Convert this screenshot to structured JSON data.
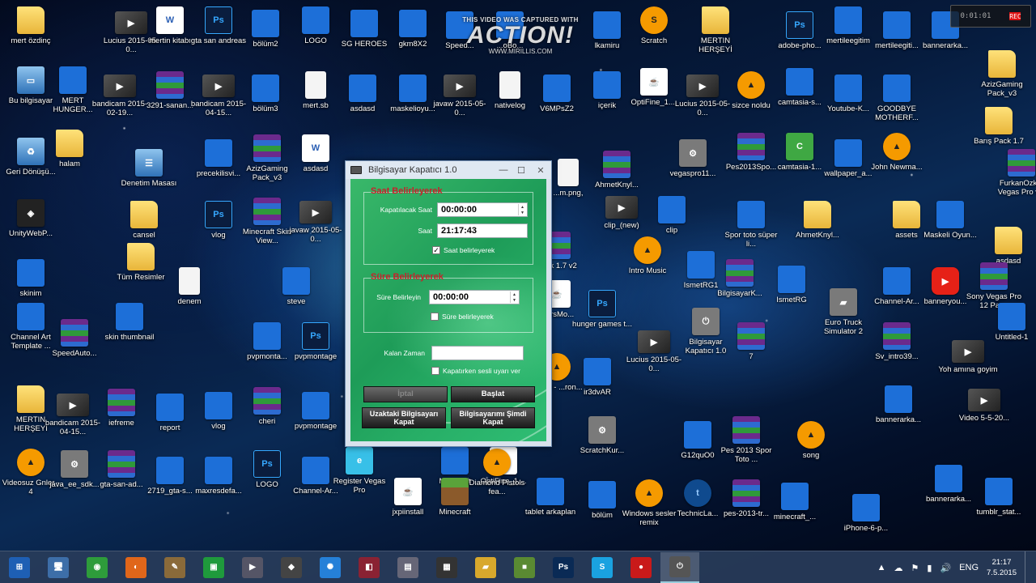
{
  "watermark": {
    "top_text": "THIS VIDEO WAS CAPTURED WITH",
    "logo": "ACTION!",
    "url": "WWW.MIRILLIS.COM"
  },
  "recorder": {
    "timer": "0:01:01",
    "rec": "REC"
  },
  "desktop_icons": [
    {
      "label": "mert özdinç",
      "icon": "folder-icon"
    },
    {
      "label": "Lucius 2015-05-0...",
      "icon": "video-icon"
    },
    {
      "label": "mertin kitabı",
      "icon": "word-icon"
    },
    {
      "label": "gta san andreas",
      "icon": "psd-icon"
    },
    {
      "label": "bölüm2",
      "icon": "image-icon"
    },
    {
      "label": "LOGO",
      "icon": "image-icon"
    },
    {
      "label": "SG HEROES",
      "icon": "image-icon"
    },
    {
      "label": "gkm8X2",
      "icon": "image-icon"
    },
    {
      "label": "Speed...",
      "icon": "image-icon"
    },
    {
      "label": "...oBo...",
      "icon": "image-icon"
    },
    {
      "label": "lkamiru",
      "icon": "image-icon"
    },
    {
      "label": "Scratch",
      "icon": "scratch-icon"
    },
    {
      "label": "MERTIN HERŞEYİ",
      "icon": "folder-icon"
    },
    {
      "label": "adobe-pho...",
      "icon": "psd-icon"
    },
    {
      "label": "mertileegitim",
      "icon": "image-icon"
    },
    {
      "label": "mertileegiti...",
      "icon": "image-icon"
    },
    {
      "label": "bannerarka...",
      "icon": "image-icon"
    },
    {
      "label": "Bu bilgisayar",
      "icon": "computer-icon"
    },
    {
      "label": "MERT HUNGER...",
      "icon": "image-icon"
    },
    {
      "label": "bandicam 2015-02-19...",
      "icon": "video-icon"
    },
    {
      "label": "3291-sanan...",
      "icon": "rar-icon"
    },
    {
      "label": "bandicam 2015-04-15...",
      "icon": "video-icon"
    },
    {
      "label": "bölüm3",
      "icon": "image-icon"
    },
    {
      "label": "mert.sb",
      "icon": "document-icon"
    },
    {
      "label": "asdasd",
      "icon": "image-icon"
    },
    {
      "label": "maskelioyu...",
      "icon": "image-icon"
    },
    {
      "label": "javaw 2015-05-0...",
      "icon": "video-icon"
    },
    {
      "label": "nativelog",
      "icon": "document-icon"
    },
    {
      "label": "V6MPsZ2",
      "icon": "image-icon"
    },
    {
      "label": "içerik",
      "icon": "image-icon"
    },
    {
      "label": "OptiFine_1....",
      "icon": "java-icon"
    },
    {
      "label": "Lucius 2015-05-0...",
      "icon": "video-icon"
    },
    {
      "label": "sizce noldu",
      "icon": "vlc-icon"
    },
    {
      "label": "camtasia-s...",
      "icon": "image-icon"
    },
    {
      "label": "Youtube-K...",
      "icon": "image-icon"
    },
    {
      "label": "GOODBYE MOTHERF...",
      "icon": "image-icon"
    },
    {
      "label": "AzizGaming Pack_v3",
      "icon": "folder-icon"
    },
    {
      "label": "Geri Dönüşü...",
      "icon": "recycle-bin-icon"
    },
    {
      "label": "halam",
      "icon": "folder-icon"
    },
    {
      "label": "Denetim Masası",
      "icon": "control-panel-icon"
    },
    {
      "label": "precekilisvi...",
      "icon": "image-icon"
    },
    {
      "label": "AzizGaming Pack_v3",
      "icon": "rar-icon"
    },
    {
      "label": "asdasd",
      "icon": "word-icon"
    },
    {
      "label": "AhmetKnyl...",
      "icon": "rar-icon"
    },
    {
      "label": "vegaspro11...",
      "icon": "installer-icon"
    },
    {
      "label": "Pes2013Spo...",
      "icon": "rar-icon"
    },
    {
      "label": "camtasia-1...",
      "icon": "camtasia-icon"
    },
    {
      "label": "wallpaper_a...",
      "icon": "image-icon"
    },
    {
      "label": "John Newma...",
      "icon": "vlc-icon"
    },
    {
      "label": "Barış Pack 1.7",
      "icon": "folder-icon"
    },
    {
      "label": "FurkanOzk... Vegas Pro v...",
      "icon": "rar-icon"
    },
    {
      "label": "UnityWebP...",
      "icon": "unity-icon"
    },
    {
      "label": "cansel",
      "icon": "folder-icon"
    },
    {
      "label": "vlog",
      "icon": "psd-icon"
    },
    {
      "label": "Minecraft Skin View...",
      "icon": "rar-icon"
    },
    {
      "label": "javaw 2015-05-0...",
      "icon": "video-icon"
    },
    {
      "label": "clip_(new)",
      "icon": "video-icon"
    },
    {
      "label": "clip",
      "icon": "image-icon"
    },
    {
      "label": "Spor toto süper li...",
      "icon": "image-icon"
    },
    {
      "label": "AhmetKnyl...",
      "icon": "folder-icon"
    },
    {
      "label": "assets",
      "icon": "folder-icon"
    },
    {
      "label": "Maskeli Oyun...",
      "icon": "image-icon"
    },
    {
      "label": "asdasd",
      "icon": "folder-icon"
    },
    {
      "label": "skinim",
      "icon": "image-icon"
    },
    {
      "label": "Tüm Resimler",
      "icon": "folder-icon"
    },
    {
      "label": "denem",
      "icon": "document-icon"
    },
    {
      "label": "steve",
      "icon": "image-icon"
    },
    {
      "label": "Intro Music",
      "icon": "vlc-icon"
    },
    {
      "label": "IsmetRG1",
      "icon": "image-icon"
    },
    {
      "label": "BilgisayarK...",
      "icon": "rar-icon"
    },
    {
      "label": "IsmetRG",
      "icon": "image-icon"
    },
    {
      "label": "Channel-Ar...",
      "icon": "image-icon"
    },
    {
      "label": "banneryou...",
      "icon": "youtube-icon"
    },
    {
      "label": "Sony Vegas Pro 12 Pat...",
      "icon": "rar-icon"
    },
    {
      "label": "Channel Art Template ...",
      "icon": "image-icon"
    },
    {
      "label": "SpeedAuto...",
      "icon": "rar-icon"
    },
    {
      "label": "skin thumbnail",
      "icon": "image-icon"
    },
    {
      "label": "pvpmonta...",
      "icon": "image-icon"
    },
    {
      "label": "pvpmontage",
      "icon": "psd-icon"
    },
    {
      "label": "hunger games t...",
      "icon": "psd-icon"
    },
    {
      "label": "Lucius 2015-05-0...",
      "icon": "video-icon"
    },
    {
      "label": "Bilgisayar Kapatıcı 1.0",
      "icon": "app-icon"
    },
    {
      "label": "7",
      "icon": "rar-icon"
    },
    {
      "label": "Euro Truck Simulator 2",
      "icon": "truck-icon"
    },
    {
      "label": "Sv_intro39...",
      "icon": "rar-icon"
    },
    {
      "label": "Untitled-1",
      "icon": "image-icon"
    },
    {
      "label": "Yoh amına goyim",
      "icon": "video-icon"
    },
    {
      "label": "MERTIN HERŞEYİ",
      "icon": "folder-icon"
    },
    {
      "label": "bandicam 2015-04-15...",
      "icon": "video-icon"
    },
    {
      "label": "iefreme",
      "icon": "rar-icon"
    },
    {
      "label": "report",
      "icon": "image-icon"
    },
    {
      "label": "vlog",
      "icon": "image-icon"
    },
    {
      "label": "cheri",
      "icon": "rar-icon"
    },
    {
      "label": "pvpmontage",
      "icon": "image-icon"
    },
    {
      "label": "ir3dvAR",
      "icon": "image-icon"
    },
    {
      "label": "bannerarka...",
      "icon": "image-icon"
    },
    {
      "label": "Video 5-5-20...",
      "icon": "video-icon"
    },
    {
      "label": "Videosuz Gnler - 4",
      "icon": "vlc-icon"
    },
    {
      "label": "java_ee_sdk...",
      "icon": "installer-icon"
    },
    {
      "label": "gta-san-ad...",
      "icon": "rar-icon"
    },
    {
      "label": "2719_gta-s...",
      "icon": "image-icon"
    },
    {
      "label": "maxresdefa...",
      "icon": "image-icon"
    },
    {
      "label": "LOGO",
      "icon": "psd-icon"
    },
    {
      "label": "Channel-Ar...",
      "icon": "image-icon"
    },
    {
      "label": "Register Vegas Pro",
      "icon": "ie-icon"
    },
    {
      "label": "Minecraft",
      "icon": "image-icon"
    },
    {
      "label": "OptiFine_1....",
      "icon": "java-icon"
    },
    {
      "label": "ScratchKur...",
      "icon": "installer-icon"
    },
    {
      "label": "G12quO0",
      "icon": "image-icon"
    },
    {
      "label": "Pes 2013 Spor Toto ...",
      "icon": "rar-icon"
    },
    {
      "label": "song",
      "icon": "vlc-icon"
    },
    {
      "label": "bannerarka...",
      "icon": "image-icon"
    },
    {
      "label": "tumblr_stat...",
      "icon": "image-icon"
    },
    {
      "label": "jxpiinstall",
      "icon": "java-icon"
    },
    {
      "label": "Minecraft",
      "icon": "minecraft-icon"
    },
    {
      "label": "Diamond Pistols fea...",
      "icon": "vlc-icon"
    },
    {
      "label": "tablet arkaplan",
      "icon": "image-icon"
    },
    {
      "label": "bölüm",
      "icon": "image-icon"
    },
    {
      "label": "Windows sesler remix",
      "icon": "vlc-icon"
    },
    {
      "label": "TechnicLa...",
      "icon": "technic-icon"
    },
    {
      "label": "pes-2013-tr...",
      "icon": "rar-icon"
    },
    {
      "label": "minecraft_...",
      "icon": "image-icon"
    },
    {
      "label": "iPhone-6-p...",
      "icon": "image-icon"
    },
    {
      "label": "Pack 1.7 v2",
      "icon": "rar-icon"
    },
    {
      "label": "...ersMo...",
      "icon": "java-icon"
    },
    {
      "label": "...zoid - ...ron...",
      "icon": "vlc-icon"
    },
    {
      "label": "...m.png,",
      "icon": "document-icon"
    }
  ],
  "app": {
    "title": "Bilgisayar Kapatıcı 1.0",
    "minimize": "—",
    "maximize": "☐",
    "close": "✕",
    "time_group": {
      "title": "Saat Belirleyerek",
      "shutdown_time_label": "Kapatılacak Saat",
      "shutdown_time_value": "00:00:00",
      "clock_label": "Saat",
      "clock_value": "21:17:43",
      "checkbox_label": "Saat belirleyerek",
      "checkbox_checked": true
    },
    "duration_group": {
      "title": "Süre Belirleyerek",
      "duration_label": "Süre Belirleyin",
      "duration_value": "00:00:00",
      "checkbox_label": "Süre belirleyerek",
      "checkbox_checked": false
    },
    "remaining_label": "Kalan Zaman",
    "remaining_value": "",
    "sound_checkbox_label": "Kapatırken sesli uyarı ver",
    "cancel_button": "İptal",
    "start_button": "Başlat",
    "remote_button": "Uzaktaki Bilgisayarı Kapat",
    "now_button": "Bilgisayarımı Şimdi Kapat"
  },
  "taskbar": {
    "items": [
      {
        "name": "start-button",
        "glyph": "⊞",
        "color": "#1e5fb4"
      },
      {
        "name": "explorer-app",
        "glyph": "🖥",
        "color": "#3d6ea8"
      },
      {
        "name": "chrome-app",
        "glyph": "◉",
        "color": "#2e9c3b"
      },
      {
        "name": "firefox-app",
        "glyph": "◐",
        "color": "#e0661a"
      },
      {
        "name": "paint-app",
        "glyph": "✎",
        "color": "#8a6a3a"
      },
      {
        "name": "store-app",
        "glyph": "▣",
        "color": "#1f9a3c"
      },
      {
        "name": "game-app",
        "glyph": "▶",
        "color": "#556"
      },
      {
        "name": "movie-app",
        "glyph": "◆",
        "color": "#444"
      },
      {
        "name": "weather-app",
        "glyph": "✺",
        "color": "#2580d8"
      },
      {
        "name": "video-editor-app",
        "glyph": "◧",
        "color": "#8a2233"
      },
      {
        "name": "drive-app",
        "glyph": "▤",
        "color": "#667"
      },
      {
        "name": "terminal-app",
        "glyph": "▦",
        "color": "#333"
      },
      {
        "name": "file-explorer-app",
        "glyph": "▰",
        "color": "#d8a82c"
      },
      {
        "name": "minecraft-app",
        "glyph": "■",
        "color": "#5a8a32"
      },
      {
        "name": "photoshop-app",
        "glyph": "Ps",
        "color": "#0a2a55"
      },
      {
        "name": "skype-app",
        "glyph": "S",
        "color": "#1aa2e0"
      },
      {
        "name": "action-recorder-app",
        "glyph": "●",
        "color": "#c91a1a"
      },
      {
        "name": "shutdown-app",
        "glyph": "⏻",
        "color": "#555"
      }
    ],
    "active_index": 17,
    "tray_icons": [
      "▲",
      "☁",
      "⚑",
      "▮",
      "🔊",
      "ENG"
    ],
    "time": "21:17",
    "date": "7.5.2015"
  }
}
